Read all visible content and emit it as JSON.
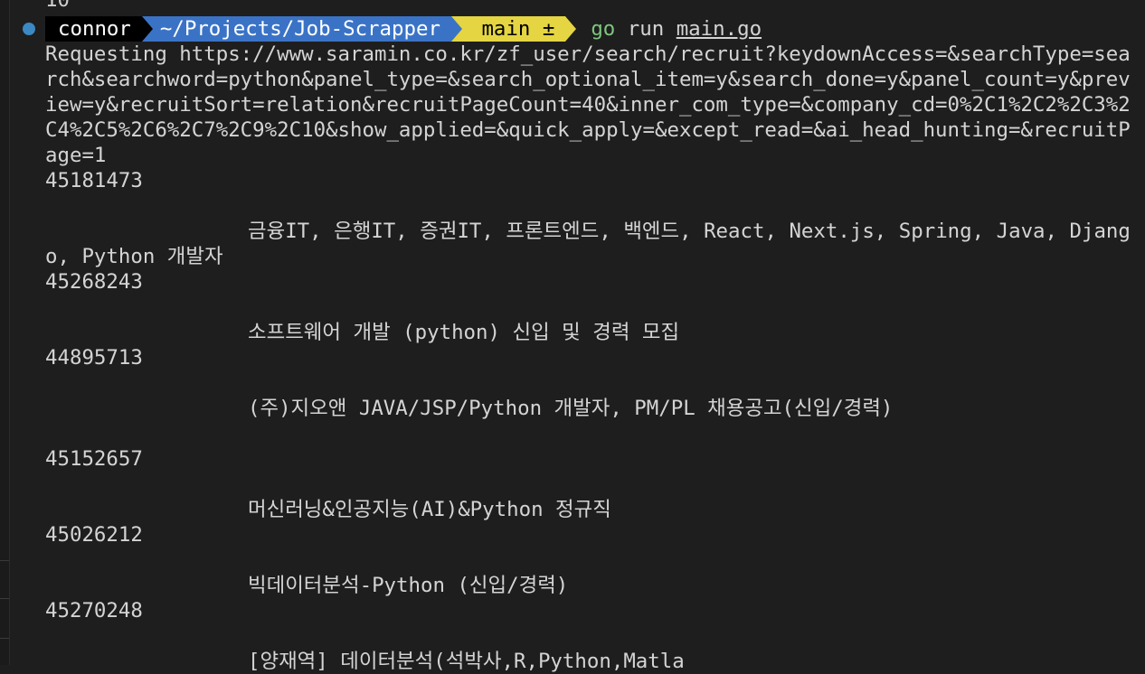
{
  "terminal": {
    "top_partial": "10",
    "prompt": {
      "user": "connor",
      "path": "~/Projects/Job-Scrapper",
      "git_icon": "",
      "branch": "main ±",
      "command_go": "go",
      "command_rest": " run ",
      "command_file": "main.go"
    },
    "request_line": "Requesting https://www.saramin.co.kr/zf_user/search/recruit?keydownAccess=&searchType=search&searchword=python&panel_type=&search_optional_item=y&search_done=y&panel_count=y&preview=y&recruitSort=relation&recruitPageCount=40&inner_com_type=&company_cd=0%2C1%2C2%2C3%2C4%2C5%2C6%2C7%2C9%2C10&show_applied=&quick_apply=&except_read=&ai_head_hunting=&recruitPage=1",
    "jobs": [
      {
        "id": "45181473",
        "title": "금융IT, 은행IT, 증권IT, 프론트엔드, 백엔드, React, Next.js, Spring, Java, Django, Python 개발자",
        "trailing_blank": false
      },
      {
        "id": "45268243",
        "title": "소프트웨어 개발 (python) 신입 및 경력 모집",
        "trailing_blank": false
      },
      {
        "id": "44895713",
        "title": "(주)지오앤 JAVA/JSP/Python 개발자, PM/PL 채용공고(신입/경력)",
        "trailing_blank": true
      },
      {
        "id": "45152657",
        "title": "머신러닝&인공지능(AI)&Python 정규직",
        "trailing_blank": false
      },
      {
        "id": "45026212",
        "title": "빅데이터분석-Python (신입/경력)",
        "trailing_blank": false
      },
      {
        "id": "45270248",
        "title": "[양재역] 데이터분석(석박사,R,Python,Matla",
        "trailing_blank": false
      }
    ]
  }
}
